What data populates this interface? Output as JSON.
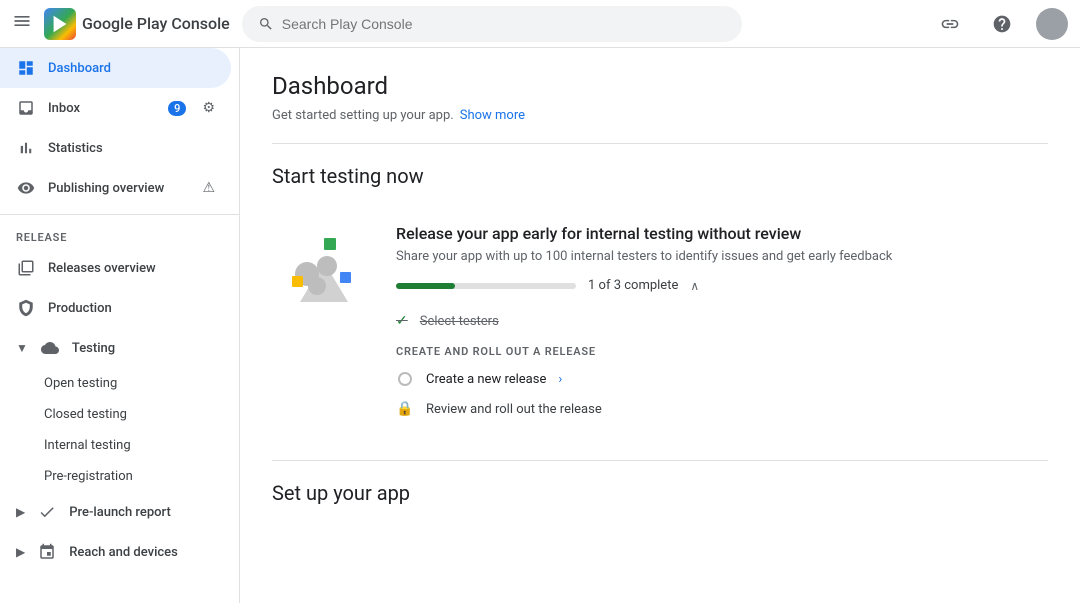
{
  "topbar": {
    "menu_icon": "☰",
    "app_name": "Google Play Console",
    "search_placeholder": "Search Play Console",
    "link_icon": "🔗",
    "help_icon": "?"
  },
  "sidebar": {
    "dashboard_label": "Dashboard",
    "inbox_label": "Inbox",
    "inbox_badge": "9",
    "statistics_label": "Statistics",
    "publishing_overview_label": "Publishing overview",
    "release_section": "Release",
    "releases_overview_label": "Releases overview",
    "production_label": "Production",
    "testing_label": "Testing",
    "open_testing_label": "Open testing",
    "closed_testing_label": "Closed testing",
    "internal_testing_label": "Internal testing",
    "pre_registration_label": "Pre-registration",
    "pre_launch_report_label": "Pre-launch report",
    "reach_devices_label": "Reach and devices"
  },
  "main": {
    "title": "Dashboard",
    "subtitle": "Get started setting up your app.",
    "show_more": "Show more",
    "start_testing_title": "Start testing now",
    "card_title": "Release your app early for internal testing without review",
    "card_desc": "Share your app with up to 100 internal testers to identify issues and get early feedback",
    "progress_text": "1 of 3 complete",
    "progress_pct": 33,
    "step1": "Select testers",
    "cta_section": "CREATE AND ROLL OUT A RELEASE",
    "cta1": "Create a new release",
    "cta1_arrow": "›",
    "cta2": "Review and roll out the release",
    "setup_title": "Set up your app"
  },
  "colors": {
    "active_bg": "#e8f0fe",
    "active_text": "#1a73e8",
    "progress_fill": "#1e7e34",
    "progress_fill_pct": "33%"
  }
}
